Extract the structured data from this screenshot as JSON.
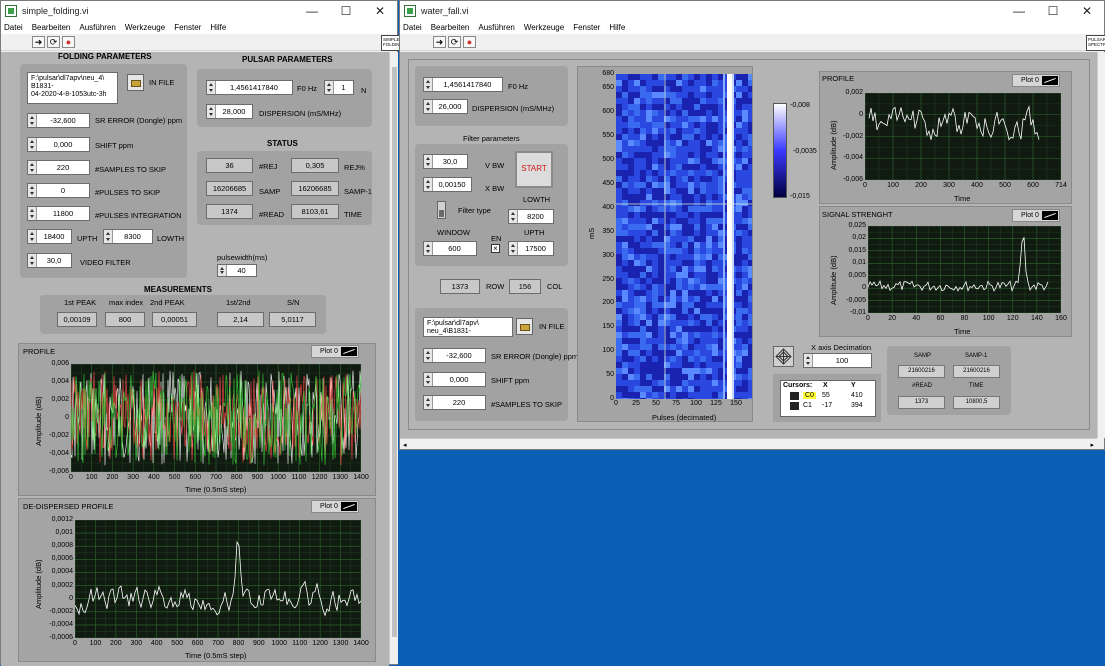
{
  "left_window": {
    "title": "simple_folding.vi",
    "menu": [
      "Datei",
      "Bearbeiten",
      "Ausführen",
      "Werkzeuge",
      "Fenster",
      "Hilfe"
    ],
    "vi_icon_text": "SIMPLE FOLDING",
    "folding": {
      "header": "FOLDING PARAMETERS",
      "in_file_path": "F:\\pulsar\\dl7apv\\neu_4\\\nB1831-\n04-2020-4-8-1053utc-3h",
      "in_file_label": "IN FILE",
      "sr_error_value": "-32,600",
      "sr_error_label": "SR ERROR (Dongle) ppm",
      "shift_value": "0,000",
      "shift_label": "SHIFT ppm",
      "samples_skip_value": "220",
      "samples_skip_label": "#SAMPLES TO SKIP",
      "pulses_skip_value": "0",
      "pulses_skip_label": "#PULSES TO SKIP",
      "pulses_int_value": "11800",
      "pulses_int_label": "#PULSES INTEGRATION",
      "upth_value": "18400",
      "upth_label": "UPTH",
      "lowth_value": "8300",
      "lowth_label": "LOWTH",
      "video_filter_value": "30,0",
      "video_filter_label": "VIDEO FILTER"
    },
    "pulsar": {
      "header": "PULSAR PARAMETERS",
      "f0_value": "1,4561417840",
      "f0_label": "F0 Hz",
      "n_value": "1",
      "n_label": "N",
      "dispersion_value": "28,000",
      "dispersion_label": "DISPERSION (mS/MHz)"
    },
    "status": {
      "header": "STATUS",
      "rej_value": "36",
      "rej_label": "#REJ",
      "rejp_value": "0,305",
      "rejp_label": "REJ%",
      "samp_value": "16206685",
      "samp_label": "SAMP",
      "samp1_value": "16206685",
      "samp1_label": "SAMP-1",
      "read_value": "1374",
      "read_label": "#READ",
      "time_value": "8103,61",
      "time_label": "TIME"
    },
    "pulsewidth_label": "pulsewidth(ms)",
    "pulsewidth_value": "40",
    "measurements": {
      "header": "MEASUREMENTS",
      "col1": "1st PEAK",
      "col2": "max index",
      "col3": "2nd PEAK",
      "col4": "1st/2nd",
      "col5": "S/N",
      "v1": "0,00109",
      "v2": "800",
      "v3": "0,00051",
      "v4": "2,14",
      "v5": "5,0117"
    },
    "profile": {
      "title": "PROFILE",
      "legend": "Plot 0",
      "ylabel": "Amplitude (dB)",
      "xlabel": "Time (0.5mS step)",
      "yticks": [
        "0,006",
        "0,004",
        "0,002",
        "0",
        "-0,002",
        "-0,004",
        "-0,006"
      ],
      "xticks": [
        "0",
        "100",
        "200",
        "300",
        "400",
        "500",
        "600",
        "700",
        "800",
        "900",
        "1000",
        "1100",
        "1200",
        "1300",
        "1400"
      ]
    },
    "dedispersed": {
      "title": "DE-DISPERSED PROFILE",
      "legend": "Plot 0",
      "ylabel": "Amplitude (dB)",
      "xlabel": "Time (0.5mS step)",
      "yticks": [
        "0,0012",
        "0,001",
        "0,0008",
        "0,0006",
        "0,0004",
        "0,0002",
        "0",
        "-0,0002",
        "-0,0004",
        "-0,0006"
      ],
      "xticks": [
        "0",
        "100",
        "200",
        "300",
        "400",
        "500",
        "600",
        "700",
        "800",
        "900",
        "1000",
        "1100",
        "1200",
        "1300",
        "1400"
      ]
    }
  },
  "right_window": {
    "title": "water_fall.vi",
    "menu": [
      "Datei",
      "Bearbeiten",
      "Ausführen",
      "Werkzeuge",
      "Fenster",
      "Hilfe"
    ],
    "vi_icon_text": "PULSAR SPECTR",
    "f0_value": "1,4561417840",
    "f0_label": "F0 Hz",
    "dispersion_value": "26,000",
    "dispersion_label": "DISPERSION (mS/MHz)",
    "filter": {
      "header": "Filter parameters",
      "vbw_value": "30,0",
      "vbw_label": "V BW",
      "xbw_value": "0,00150",
      "xbw_label": "X BW",
      "start_label": "START",
      "filter_type_label": "Filter type",
      "lowth_label": "LOWTH",
      "lowth_value": "8200",
      "window_label": "WINDOW",
      "window_value": "600",
      "en_label": "EN",
      "en_check": "×",
      "upth_label": "UPTH",
      "upth_value": "17500"
    },
    "row_value": "1373",
    "row_label": "ROW",
    "col_value": "156",
    "col_label": "COL",
    "in_file_path": "F:\\pulsar\\dl7apv\\\nneu_4\\B1831-",
    "in_file_label": "IN FILE",
    "sr_error_value": "-32,600",
    "sr_error_label": "SR ERROR (Dongle) ppm",
    "shift_value": "0,000",
    "shift_label": "SHIFT ppm",
    "samples_skip_value": "220",
    "samples_skip_label": "#SAMPLES TO SKIP",
    "waterfall": {
      "ylabel": "mS",
      "xlabel": "Pulses (decimated)",
      "yticks": [
        "680",
        "650",
        "600",
        "550",
        "500",
        "450",
        "400",
        "350",
        "300",
        "250",
        "200",
        "150",
        "100",
        "50",
        "0"
      ],
      "xticks": [
        "0",
        "25",
        "50",
        "75",
        "100",
        "125",
        "150"
      ],
      "ramp_ticks": [
        "-0,008",
        "-0,0035",
        "-0,015"
      ]
    },
    "profile": {
      "title": "PROFILE",
      "legend": "Plot 0",
      "ylabel": "Amplitude (dB)",
      "xlabel": "Time",
      "yticks": [
        "0,002",
        "0",
        "-0,002",
        "-0,004",
        "-0,006"
      ],
      "xticks": [
        "0",
        "100",
        "200",
        "300",
        "400",
        "500",
        "600",
        "714"
      ]
    },
    "signal": {
      "title": "SIGNAL STRENGHT",
      "legend": "Plot 0",
      "ylabel": "Amplitude (dB)",
      "xlabel": "Time",
      "yticks": [
        "0,025",
        "0,02",
        "0,015",
        "0,01",
        "0,005",
        "0",
        "-0,005",
        "-0,01"
      ],
      "xticks": [
        "0",
        "20",
        "40",
        "60",
        "80",
        "100",
        "120",
        "140",
        "160"
      ]
    },
    "decimation_label": "X axis Decimation",
    "decimation_value": "100",
    "cursors": {
      "header": "Cursors:",
      "x": "X",
      "y": "Y",
      "c0": "C0",
      "c1": "C1",
      "c0x": "55",
      "c0y": "410",
      "c1x": "-17",
      "c1y": "394"
    },
    "status": {
      "samp_label": "SAMP",
      "samp_value": "21600216",
      "samp1_label": "SAMP-1",
      "samp1_value": "21600216",
      "read_label": "#READ",
      "read_value": "1373",
      "time_label": "TIME",
      "time_value": "10800,5"
    }
  }
}
